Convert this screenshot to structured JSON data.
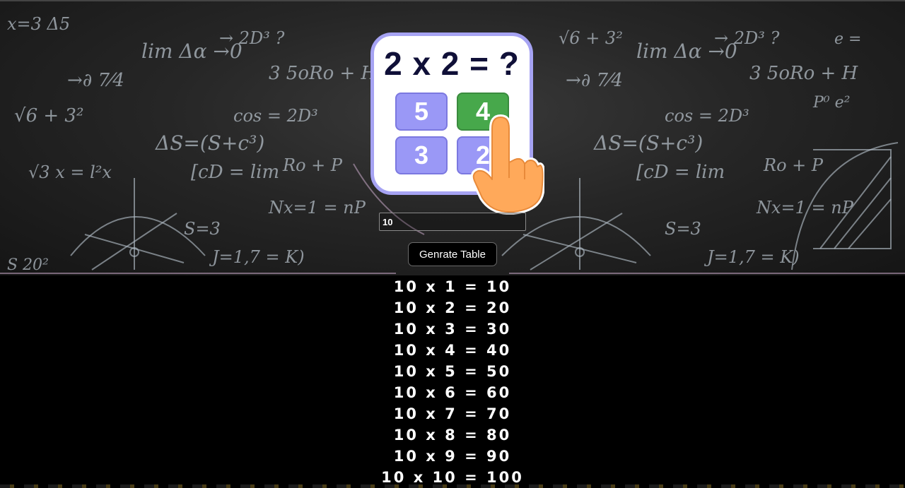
{
  "game_card": {
    "question": "2 x 2 = ?",
    "options": [
      "5",
      "4",
      "3",
      "2"
    ],
    "correct_option": "4",
    "colors": {
      "border": "#a6a3f3",
      "option": "#9a98f6",
      "correct": "#47a84b",
      "question_text": "#101038"
    }
  },
  "form": {
    "number_value": "10",
    "button_label": "Genrate Table"
  },
  "table_rows": [
    "10 x 1 = 10",
    "10 x 2 = 20",
    "10 x 3 = 30",
    "10 x 4 = 40",
    "10 x 5 = 50",
    "10 x 6 = 60",
    "10 x 7 = 70",
    "10 x 8 = 80",
    "10 x 9 = 90",
    "10 x 10 = 100"
  ],
  "icons": {
    "hand": "pointing-hand-icon"
  }
}
